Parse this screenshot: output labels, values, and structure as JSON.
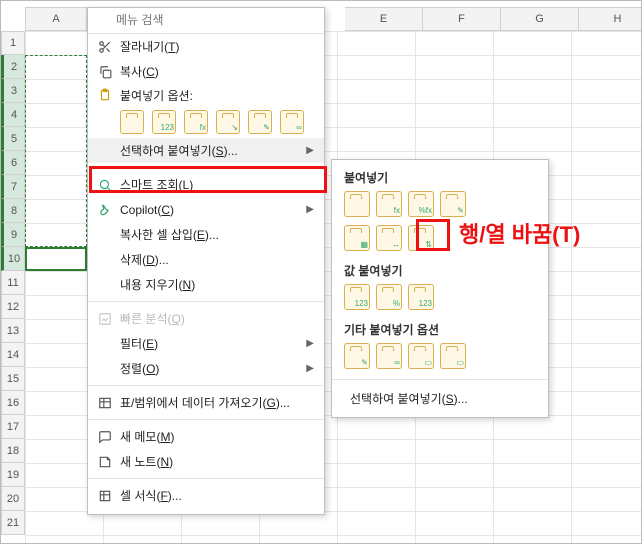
{
  "columns": {
    "A": "A",
    "E": "E",
    "F": "F",
    "G": "G",
    "H": "H"
  },
  "rows": [
    "1",
    "2",
    "3",
    "4",
    "5",
    "6",
    "7",
    "8",
    "9",
    "10",
    "11",
    "12",
    "13",
    "14",
    "15",
    "16",
    "17",
    "18",
    "19",
    "20",
    "21"
  ],
  "menu": {
    "search_placeholder": "메뉴 검색",
    "cut": "잘라내기(T̲)",
    "copy": "복사(C̲)",
    "paste_opts_label": "붙여넣기 옵션:",
    "paste_special": "선택하여 붙여넣기(S̲)...",
    "smart_lookup": "스마트 조회(L̲)",
    "copilot": "Copilot(C̲)",
    "insert_copied": "복사한 셀 삽입(E̲)...",
    "delete": "삭제(D̲)...",
    "clear": "내용 지우기(N̲)",
    "quick_analysis": "빠른 분석(Q̲)",
    "filter": "필터(E̲)",
    "sort": "정렬(O̲)",
    "get_data": "표/범위에서 데이터 가져오기(G̲)...",
    "new_comment": "새 메모(M̲)",
    "new_note": "새 노트(N̲)",
    "format": "셀 서식(F̲)...",
    "paste_icons": {
      "all": "",
      "values": "123",
      "formulas": "fx",
      "ref": "↘",
      "fmt": "✎",
      "link": "∞"
    }
  },
  "submenu": {
    "paste_hdr": "붙여넣기",
    "vals_hdr": "값 붙여넣기",
    "other_hdr": "기타 붙여넣기 옵션",
    "footer": "선택하여 붙여넣기(S̲)...",
    "row1": {
      "all": "",
      "fx": "fx",
      "fxnum": "%fx",
      "srcfmt": "✎"
    },
    "row2": {
      "noborder": "▦",
      "colw": "↔",
      "transpose": "⇅"
    },
    "vals": {
      "v123": "123",
      "vnum": "%",
      "vfmt": "123"
    },
    "other": {
      "fmt": "✎",
      "link": "∞",
      "pic": "▭",
      "piclink": "▭"
    }
  },
  "annotation": {
    "transpose_label": "행/열 바꿈(T)"
  }
}
